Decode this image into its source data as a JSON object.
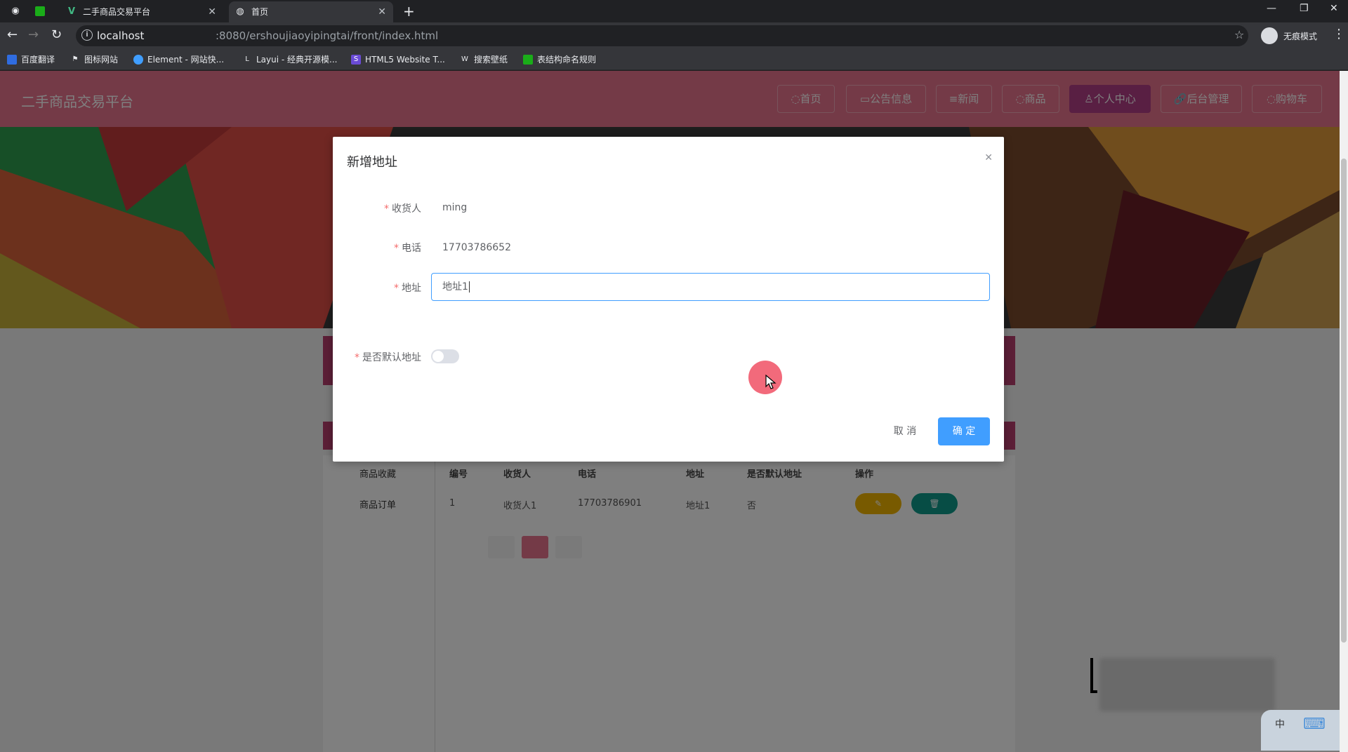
{
  "browser": {
    "tabs": [
      {
        "title": "二手商品交易平台",
        "active": false
      },
      {
        "title": "首页",
        "active": true
      }
    ],
    "url_host": "localhost",
    "url_path": ":8080/ershoujiaoyipingtai/front/index.html",
    "incognito_label": "无痕模式",
    "bookmarks": [
      "百度翻译",
      "图标网站",
      "Element - 网站快...",
      "Layui - 经典开源模...",
      "HTML5 Website T...",
      "搜索壁纸",
      "表结构命名规则"
    ]
  },
  "site": {
    "title": "二手商品交易平台",
    "nav": [
      {
        "label": "首页",
        "icon": "home-icon",
        "active": false
      },
      {
        "label": "公告信息",
        "icon": "notice-icon",
        "active": false
      },
      {
        "label": "新闻",
        "icon": "news-icon",
        "active": false
      },
      {
        "label": "商品",
        "icon": "goods-icon",
        "active": false
      },
      {
        "label": "个人中心",
        "icon": "user-icon",
        "active": true
      },
      {
        "label": "后台管理",
        "icon": "link-icon",
        "active": false
      },
      {
        "label": "购物车",
        "icon": "cart-icon",
        "active": false
      }
    ],
    "accent_color": "#e8758f"
  },
  "background_page": {
    "side_menu": [
      "商品收藏",
      "商品订单"
    ],
    "table": {
      "headers": [
        "编号",
        "收货人",
        "电话",
        "地址",
        "是否默认地址",
        "操作"
      ],
      "row": [
        "1",
        "收货人1",
        "17703786901",
        "地址1",
        "否"
      ]
    }
  },
  "dialog": {
    "title": "新增地址",
    "fields": [
      {
        "label": "收货人",
        "value": "ming"
      },
      {
        "label": "电话",
        "value": "17703786652"
      },
      {
        "label": "地址",
        "value": "地址1"
      }
    ],
    "default_label": "是否默认地址",
    "default_on": false,
    "cancel_label": "取 消",
    "ok_label": "确 定",
    "primary_color": "#409eff"
  },
  "ime": {
    "mode": "中"
  }
}
